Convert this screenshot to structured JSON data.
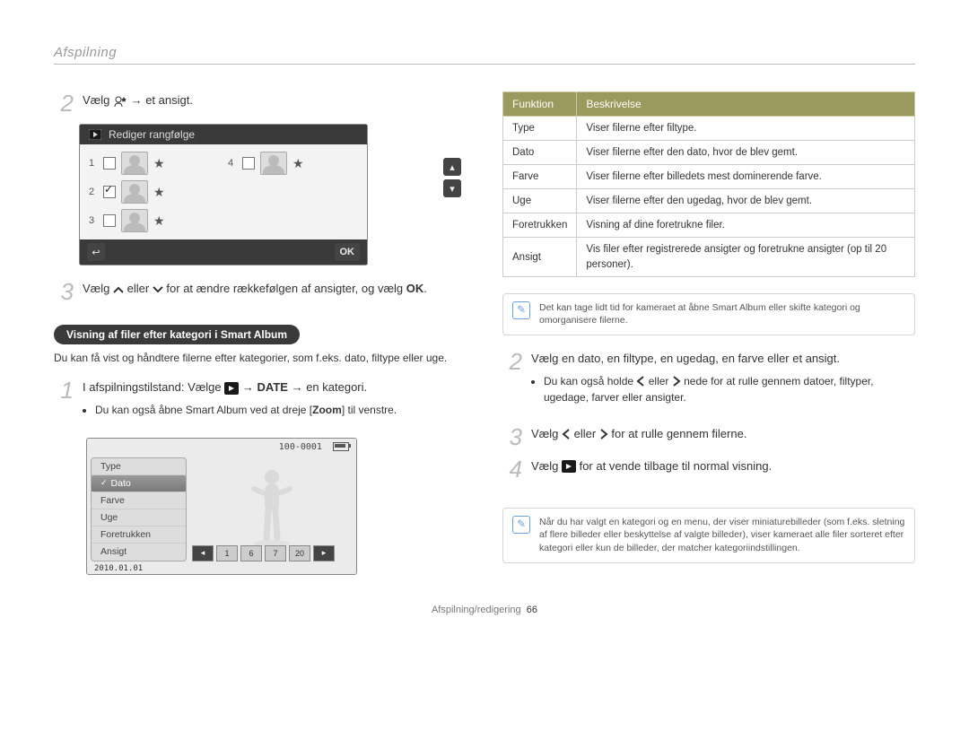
{
  "header": "Afspilning",
  "footer": {
    "label": "Afspilning/redigering",
    "page": "66"
  },
  "left": {
    "step2": {
      "num": "2",
      "text": "Vælg ",
      "tail": " → et ansigt."
    },
    "lcd_title": "Rediger rangfølge",
    "lcd_rows": [
      {
        "n": "1",
        "checked": false
      },
      {
        "n": "2",
        "checked": true
      },
      {
        "n": "3",
        "checked": false
      },
      {
        "n": "4",
        "checked": false
      }
    ],
    "step3": {
      "num": "3",
      "text_a": "Vælg ",
      "text_b": " eller ",
      "text_c": " for at ændre rækkefølgen af ansigter, og vælg "
    },
    "heading_chip": "Visning af filer efter kategori i Smart Album",
    "chip_desc": "Du kan få vist og håndtere filerne efter kategorier, som f.eks. dato, filtype eller uge.",
    "step1": {
      "num": "1",
      "text_a": "I afspilningstilstand: Vælge ",
      "text_b": " → ",
      "text_c": " → en kategori."
    },
    "step1_bullet": "Du kan også åbne Smart Album ved at dreje [",
    "step1_bullet_bold": "Zoom",
    "step1_bullet_tail": "] til venstre.",
    "lcd2": {
      "folder": "100-0001",
      "date": "2010.01.01",
      "items": [
        "Type",
        "Dato",
        "Farve",
        "Uge",
        "Foretrukken",
        "Ansigt"
      ],
      "selected_index": 1,
      "thumbs": [
        "1",
        "6",
        "7",
        "20"
      ]
    }
  },
  "right": {
    "table_headers": [
      "Funktion",
      "Beskrivelse"
    ],
    "rows": [
      {
        "k": "Type",
        "v": "Viser filerne efter filtype."
      },
      {
        "k": "Dato",
        "v": "Viser filerne efter den dato, hvor de blev gemt."
      },
      {
        "k": "Farve",
        "v": "Viser filerne efter billedets mest dominerende farve."
      },
      {
        "k": "Uge",
        "v": "Viser filerne efter den ugedag, hvor de blev gemt."
      },
      {
        "k": "Foretrukken",
        "v": "Visning af dine foretrukne filer."
      },
      {
        "k": "Ansigt",
        "v": "Vis filer efter registrerede ansigter og foretrukne ansigter (op til 20 personer)."
      }
    ],
    "note1": "Det kan tage lidt tid for kameraet at åbne Smart Album eller skifte kategori og omorganisere filerne.",
    "step2": {
      "num": "2",
      "text": "Vælg en dato, en filtype, en ugedag, en farve eller et ansigt."
    },
    "step2_bullet_a": "Du kan også holde ",
    "step2_bullet_b": " eller ",
    "step2_bullet_c": " nede for at rulle gennem datoer, filtyper, ugedage, farver eller ansigter.",
    "step3": {
      "num": "3",
      "a": "Vælg ",
      "b": " eller ",
      "c": " for at rulle gennem filerne."
    },
    "step4": {
      "num": "4",
      "a": "Vælg ",
      "b": " for at vende tilbage til normal visning."
    },
    "note2": "Når du har valgt en kategori og en menu, der viser miniaturebilleder (som f.eks. sletning af flere billeder eller beskyttelse af valgte billeder), viser kameraet alle filer sorteret efter kategori eller kun de billeder, der matcher kategoriindstillingen."
  }
}
